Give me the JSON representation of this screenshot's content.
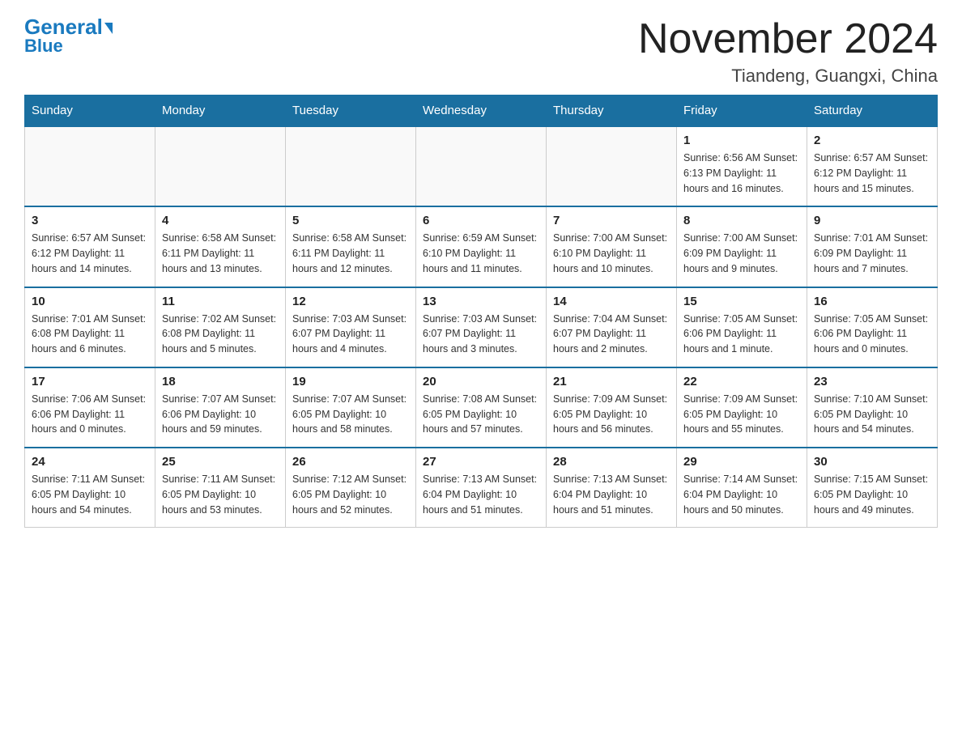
{
  "logo": {
    "general": "General",
    "blue": "Blue"
  },
  "header": {
    "month_year": "November 2024",
    "location": "Tiandeng, Guangxi, China"
  },
  "weekdays": [
    "Sunday",
    "Monday",
    "Tuesday",
    "Wednesday",
    "Thursday",
    "Friday",
    "Saturday"
  ],
  "weeks": [
    [
      {
        "day": "",
        "info": ""
      },
      {
        "day": "",
        "info": ""
      },
      {
        "day": "",
        "info": ""
      },
      {
        "day": "",
        "info": ""
      },
      {
        "day": "",
        "info": ""
      },
      {
        "day": "1",
        "info": "Sunrise: 6:56 AM\nSunset: 6:13 PM\nDaylight: 11 hours and 16 minutes."
      },
      {
        "day": "2",
        "info": "Sunrise: 6:57 AM\nSunset: 6:12 PM\nDaylight: 11 hours and 15 minutes."
      }
    ],
    [
      {
        "day": "3",
        "info": "Sunrise: 6:57 AM\nSunset: 6:12 PM\nDaylight: 11 hours and 14 minutes."
      },
      {
        "day": "4",
        "info": "Sunrise: 6:58 AM\nSunset: 6:11 PM\nDaylight: 11 hours and 13 minutes."
      },
      {
        "day": "5",
        "info": "Sunrise: 6:58 AM\nSunset: 6:11 PM\nDaylight: 11 hours and 12 minutes."
      },
      {
        "day": "6",
        "info": "Sunrise: 6:59 AM\nSunset: 6:10 PM\nDaylight: 11 hours and 11 minutes."
      },
      {
        "day": "7",
        "info": "Sunrise: 7:00 AM\nSunset: 6:10 PM\nDaylight: 11 hours and 10 minutes."
      },
      {
        "day": "8",
        "info": "Sunrise: 7:00 AM\nSunset: 6:09 PM\nDaylight: 11 hours and 9 minutes."
      },
      {
        "day": "9",
        "info": "Sunrise: 7:01 AM\nSunset: 6:09 PM\nDaylight: 11 hours and 7 minutes."
      }
    ],
    [
      {
        "day": "10",
        "info": "Sunrise: 7:01 AM\nSunset: 6:08 PM\nDaylight: 11 hours and 6 minutes."
      },
      {
        "day": "11",
        "info": "Sunrise: 7:02 AM\nSunset: 6:08 PM\nDaylight: 11 hours and 5 minutes."
      },
      {
        "day": "12",
        "info": "Sunrise: 7:03 AM\nSunset: 6:07 PM\nDaylight: 11 hours and 4 minutes."
      },
      {
        "day": "13",
        "info": "Sunrise: 7:03 AM\nSunset: 6:07 PM\nDaylight: 11 hours and 3 minutes."
      },
      {
        "day": "14",
        "info": "Sunrise: 7:04 AM\nSunset: 6:07 PM\nDaylight: 11 hours and 2 minutes."
      },
      {
        "day": "15",
        "info": "Sunrise: 7:05 AM\nSunset: 6:06 PM\nDaylight: 11 hours and 1 minute."
      },
      {
        "day": "16",
        "info": "Sunrise: 7:05 AM\nSunset: 6:06 PM\nDaylight: 11 hours and 0 minutes."
      }
    ],
    [
      {
        "day": "17",
        "info": "Sunrise: 7:06 AM\nSunset: 6:06 PM\nDaylight: 11 hours and 0 minutes."
      },
      {
        "day": "18",
        "info": "Sunrise: 7:07 AM\nSunset: 6:06 PM\nDaylight: 10 hours and 59 minutes."
      },
      {
        "day": "19",
        "info": "Sunrise: 7:07 AM\nSunset: 6:05 PM\nDaylight: 10 hours and 58 minutes."
      },
      {
        "day": "20",
        "info": "Sunrise: 7:08 AM\nSunset: 6:05 PM\nDaylight: 10 hours and 57 minutes."
      },
      {
        "day": "21",
        "info": "Sunrise: 7:09 AM\nSunset: 6:05 PM\nDaylight: 10 hours and 56 minutes."
      },
      {
        "day": "22",
        "info": "Sunrise: 7:09 AM\nSunset: 6:05 PM\nDaylight: 10 hours and 55 minutes."
      },
      {
        "day": "23",
        "info": "Sunrise: 7:10 AM\nSunset: 6:05 PM\nDaylight: 10 hours and 54 minutes."
      }
    ],
    [
      {
        "day": "24",
        "info": "Sunrise: 7:11 AM\nSunset: 6:05 PM\nDaylight: 10 hours and 54 minutes."
      },
      {
        "day": "25",
        "info": "Sunrise: 7:11 AM\nSunset: 6:05 PM\nDaylight: 10 hours and 53 minutes."
      },
      {
        "day": "26",
        "info": "Sunrise: 7:12 AM\nSunset: 6:05 PM\nDaylight: 10 hours and 52 minutes."
      },
      {
        "day": "27",
        "info": "Sunrise: 7:13 AM\nSunset: 6:04 PM\nDaylight: 10 hours and 51 minutes."
      },
      {
        "day": "28",
        "info": "Sunrise: 7:13 AM\nSunset: 6:04 PM\nDaylight: 10 hours and 51 minutes."
      },
      {
        "day": "29",
        "info": "Sunrise: 7:14 AM\nSunset: 6:04 PM\nDaylight: 10 hours and 50 minutes."
      },
      {
        "day": "30",
        "info": "Sunrise: 7:15 AM\nSunset: 6:05 PM\nDaylight: 10 hours and 49 minutes."
      }
    ]
  ]
}
